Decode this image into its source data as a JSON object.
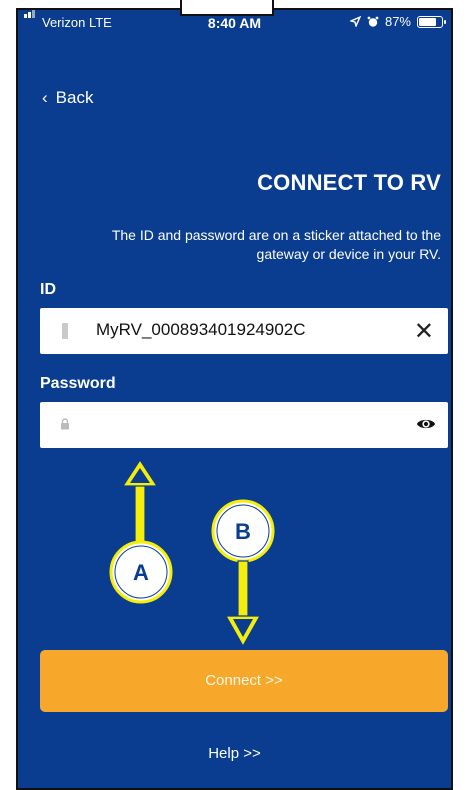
{
  "status_bar": {
    "carrier": "Verizon  LTE",
    "time": "8:40 AM",
    "battery": "87%",
    "battery_level": 0.87
  },
  "nav": {
    "back_label": "Back"
  },
  "page": {
    "title": "CONNECT TO RV",
    "subtitle": "The ID and password are on a sticker attached to the gateway or device in your RV."
  },
  "id_field": {
    "label": "ID",
    "value": "MyRV_000893401924902C"
  },
  "password_field": {
    "label": "Password",
    "placeholder": ""
  },
  "connect_label": "Connect >>",
  "help_label": "Help >>",
  "annotations": {
    "a": "A",
    "b": "B"
  },
  "colors": {
    "background": "#0a3d8f",
    "button": "#f7a82b",
    "arrow": "#f5ee0a"
  }
}
